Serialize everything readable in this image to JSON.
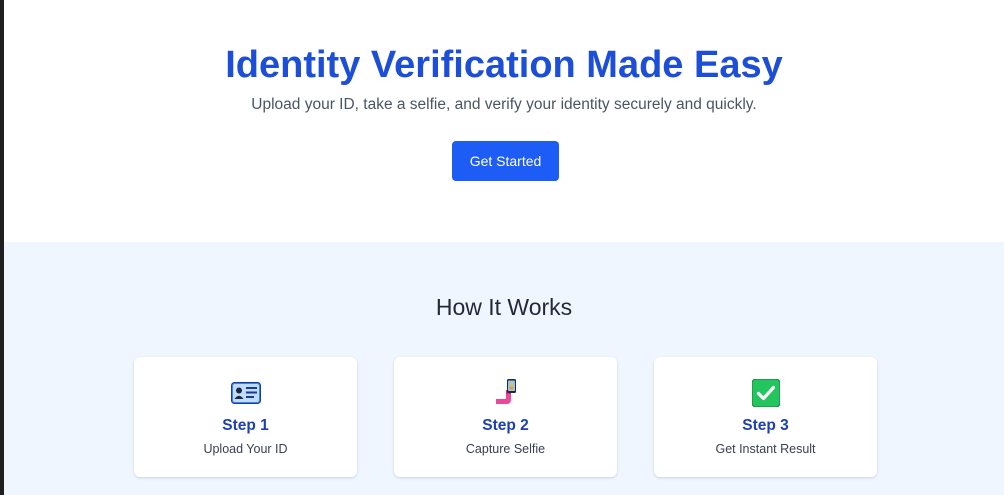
{
  "hero": {
    "title": "Identity Verification Made Easy",
    "subtitle": "Upload your ID, take a selfie, and verify your identity securely and quickly.",
    "cta_label": "Get Started"
  },
  "how_it_works": {
    "title": "How It Works",
    "steps": [
      {
        "icon": "id-card-icon",
        "title": "Step 1",
        "description": "Upload Your ID"
      },
      {
        "icon": "selfie-icon",
        "title": "Step 2",
        "description": "Capture Selfie"
      },
      {
        "icon": "check-mark-icon",
        "title": "Step 3",
        "description": "Get Instant Result"
      }
    ]
  },
  "colors": {
    "brand": "#1d4ed8",
    "button": "#1d5cf5",
    "section_bg": "#eff6ff"
  }
}
